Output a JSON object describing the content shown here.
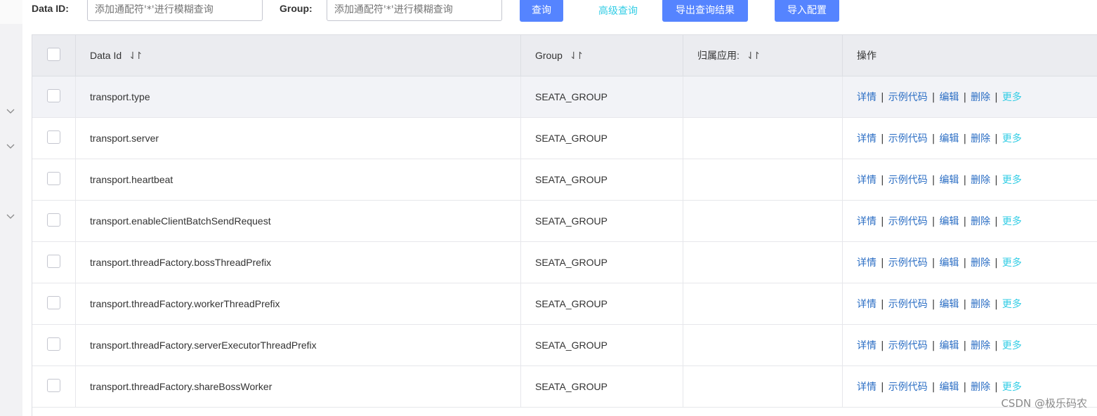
{
  "toolbar": {
    "data_id_label": "Data ID:",
    "data_id_placeholder": "添加通配符'*'进行模糊查询",
    "group_label": "Group:",
    "group_placeholder": "添加通配符'*'进行模糊查询",
    "query_button": "查询",
    "advanced_query": "高级查询",
    "export_button": "导出查询结果",
    "import_button": "导入配置"
  },
  "table": {
    "headers": {
      "data_id": "Data Id",
      "group": "Group",
      "app": "归属应用:",
      "actions": "操作"
    },
    "sort_icon": "⇃↾",
    "actions": {
      "detail": "详情",
      "sample": "示例代码",
      "edit": "编辑",
      "delete": "删除",
      "more": "更多",
      "sep": "|"
    },
    "rows": [
      {
        "data_id": "transport.type",
        "group": "SEATA_GROUP",
        "app": ""
      },
      {
        "data_id": "transport.server",
        "group": "SEATA_GROUP",
        "app": ""
      },
      {
        "data_id": "transport.heartbeat",
        "group": "SEATA_GROUP",
        "app": ""
      },
      {
        "data_id": "transport.enableClientBatchSendRequest",
        "group": "SEATA_GROUP",
        "app": ""
      },
      {
        "data_id": "transport.threadFactory.bossThreadPrefix",
        "group": "SEATA_GROUP",
        "app": ""
      },
      {
        "data_id": "transport.threadFactory.workerThreadPrefix",
        "group": "SEATA_GROUP",
        "app": ""
      },
      {
        "data_id": "transport.threadFactory.serverExecutorThreadPrefix",
        "group": "SEATA_GROUP",
        "app": ""
      },
      {
        "data_id": "transport.threadFactory.shareBossWorker",
        "group": "SEATA_GROUP",
        "app": ""
      }
    ]
  },
  "watermark": "CSDN @极乐码农",
  "colors": {
    "primary_button": "#5584ff",
    "link": "#2b6ec4",
    "more_link": "#33cde5",
    "header_bg": "#ebecf0"
  },
  "icons": {
    "gutter": [
      "chevron-down-icon",
      "chevron-down-icon",
      "chevron-down-icon"
    ],
    "sort": "sort-icon",
    "checkbox": "checkbox-icon"
  }
}
